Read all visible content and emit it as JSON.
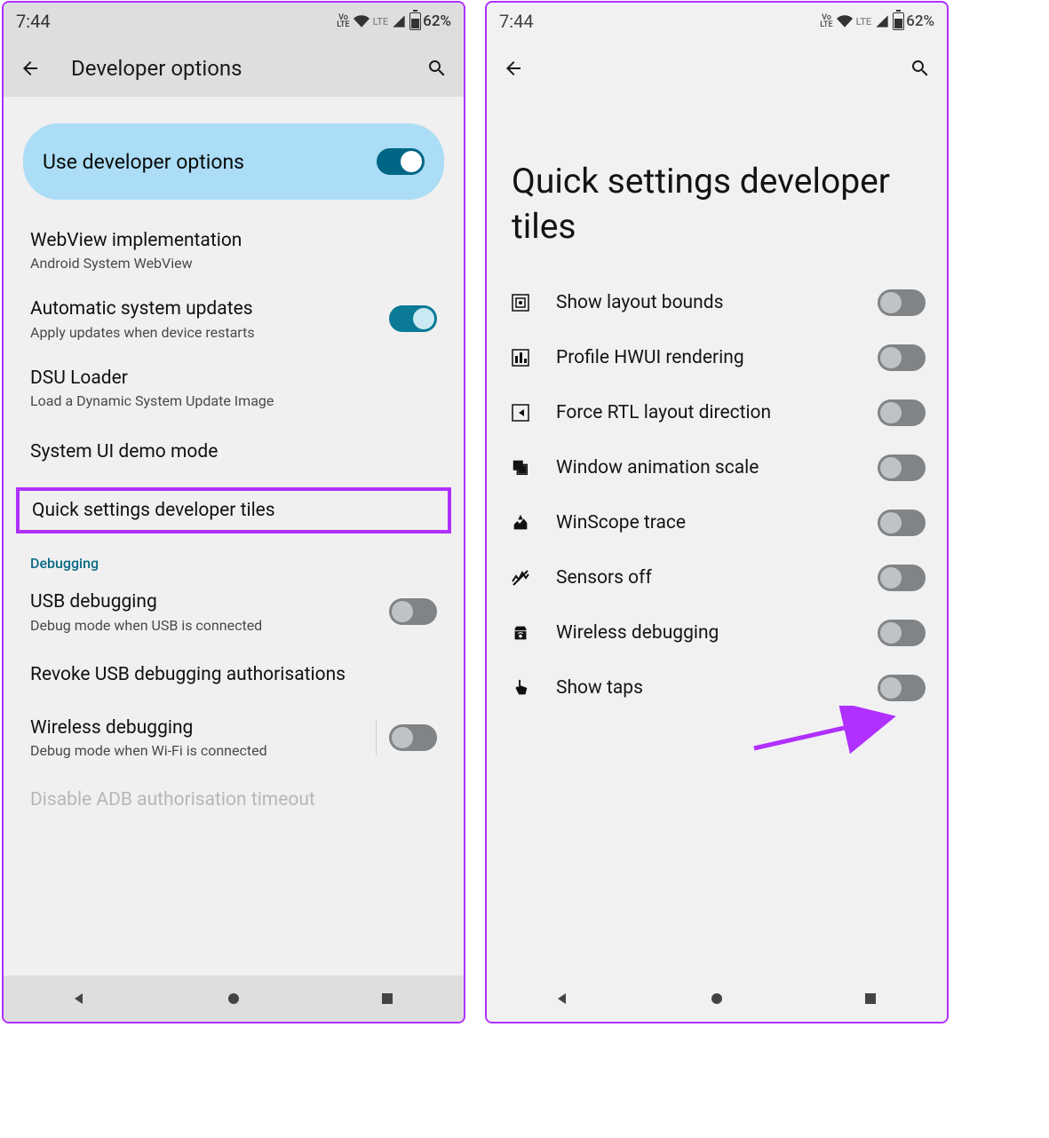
{
  "status": {
    "time": "7:44",
    "battery_pct": "62%",
    "volte": "Vo\nLTE",
    "lte": "LTE"
  },
  "left": {
    "header_title": "Developer options",
    "master_switch": "Use developer options",
    "rows": {
      "webview_t": "WebView implementation",
      "webview_s": "Android System WebView",
      "auto_t": "Automatic system updates",
      "auto_s": "Apply updates when device restarts",
      "dsu_t": "DSU Loader",
      "dsu_s": "Load a Dynamic System Update Image",
      "demo_t": "System UI demo mode",
      "qs_t": "Quick settings developer tiles",
      "section_debug": "Debugging",
      "usb_t": "USB debugging",
      "usb_s": "Debug mode when USB is connected",
      "revoke_t": "Revoke USB debugging authorisations",
      "wifi_t": "Wireless debugging",
      "wifi_s": "Debug mode when Wi-Fi is connected",
      "disable_t": "Disable ADB authorisation timeout"
    }
  },
  "right": {
    "big_title": "Quick settings developer tiles",
    "tiles": [
      {
        "id": "layout-bounds",
        "label": "Show layout bounds"
      },
      {
        "id": "hwui",
        "label": "Profile HWUI rendering"
      },
      {
        "id": "rtl",
        "label": "Force RTL layout direction"
      },
      {
        "id": "anim",
        "label": "Window animation scale"
      },
      {
        "id": "winscope",
        "label": "WinScope trace"
      },
      {
        "id": "sensors",
        "label": "Sensors off"
      },
      {
        "id": "wireless",
        "label": "Wireless debugging"
      },
      {
        "id": "taps",
        "label": "Show taps"
      }
    ]
  }
}
